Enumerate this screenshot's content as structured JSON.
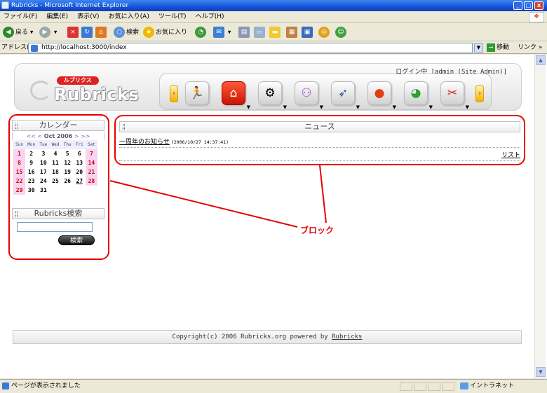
{
  "window": {
    "title": "Rubricks - Microsoft Internet Explorer",
    "minimize": "_",
    "maximize": "□",
    "close": "x"
  },
  "menu": [
    "ファイル(F)",
    "編集(E)",
    "表示(V)",
    "お気に入り(A)",
    "ツール(T)",
    "ヘルプ(H)"
  ],
  "toolbar": {
    "back": "戻る",
    "search": "検索",
    "favorites": "お気に入り"
  },
  "address": {
    "label": "アドレス(D)",
    "url": "http://localhost:3000/index",
    "go": "移動",
    "links": "リンク »"
  },
  "header": {
    "login_status": "ログイン中 [admin (Site Admin)]",
    "logo_tag": "ルブリクス",
    "logo_word": "Rubricks",
    "nav_icons": [
      "user-running-icon",
      "home-icon",
      "gears-icon",
      "sitemap-icon",
      "rocket-icon",
      "ball-icon",
      "globe-icon",
      "tools-icon"
    ]
  },
  "calendar": {
    "title": "カレンダー",
    "nav_prev_year": "<<",
    "nav_prev": "<",
    "month": "Oct 2006",
    "nav_next": ">",
    "nav_next_year": ">>",
    "weekdays": [
      "Sun",
      "Mon",
      "Tue",
      "Wed",
      "Thu",
      "Fri",
      "Sat"
    ],
    "weeks": [
      [
        "1",
        "2",
        "3",
        "4",
        "5",
        "6",
        "7"
      ],
      [
        "8",
        "9",
        "10",
        "11",
        "12",
        "13",
        "14"
      ],
      [
        "15",
        "16",
        "17",
        "18",
        "19",
        "20",
        "21"
      ],
      [
        "22",
        "23",
        "24",
        "25",
        "26",
        "27",
        "28"
      ],
      [
        "29",
        "30",
        "31",
        "",
        "",
        "",
        ""
      ]
    ],
    "today": "27"
  },
  "search": {
    "title": "Rubricks検索",
    "value": "",
    "button": "検索"
  },
  "news": {
    "title": "ニュース",
    "items": [
      {
        "title": "一周年のお知らせ",
        "date": "(2006/10/27 14:37:41)"
      }
    ],
    "list_link": "リスト"
  },
  "annotation": {
    "label": "ブロック"
  },
  "footer": {
    "copyright": "Copyright(c) 2006 Rubricks.org powered by ",
    "link": "Rubricks"
  },
  "status": {
    "text": "ページが表示されました",
    "zone": "イントラネット"
  }
}
